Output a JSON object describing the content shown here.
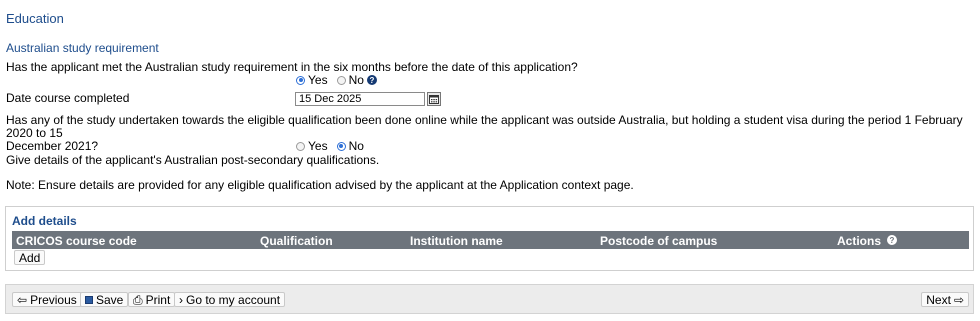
{
  "section": {
    "title": "Education"
  },
  "study_requirement": {
    "heading": "Australian study requirement",
    "question": "Has the applicant met the Australian study requirement in the six months before the date of this application?",
    "options": [
      "Yes",
      "No"
    ],
    "selected": "Yes",
    "date_label": "Date course completed",
    "date_value": "15 Dec 2025"
  },
  "online_study": {
    "question_line1": "Has any of the study undertaken towards the eligible qualification been done online while the applicant was outside Australia, but holding a student visa during the period 1 February 2020 to 15",
    "question_line2": "December 2021?",
    "options": [
      "Yes",
      "No"
    ],
    "selected": "No"
  },
  "details_prompt": "Give details of the applicant's Australian post-secondary qualifications.",
  "note": "Note: Ensure details are provided for any eligible qualification advised by the applicant at the Application context page.",
  "add_details": {
    "title": "Add details",
    "columns": [
      "CRICOS course code",
      "Qualification",
      "Institution name",
      "Postcode of campus",
      "Actions"
    ],
    "add_button": "Add"
  },
  "nav": {
    "previous": "Previous",
    "save": "Save",
    "print": "Print",
    "account": "Go to my account",
    "next": "Next"
  }
}
